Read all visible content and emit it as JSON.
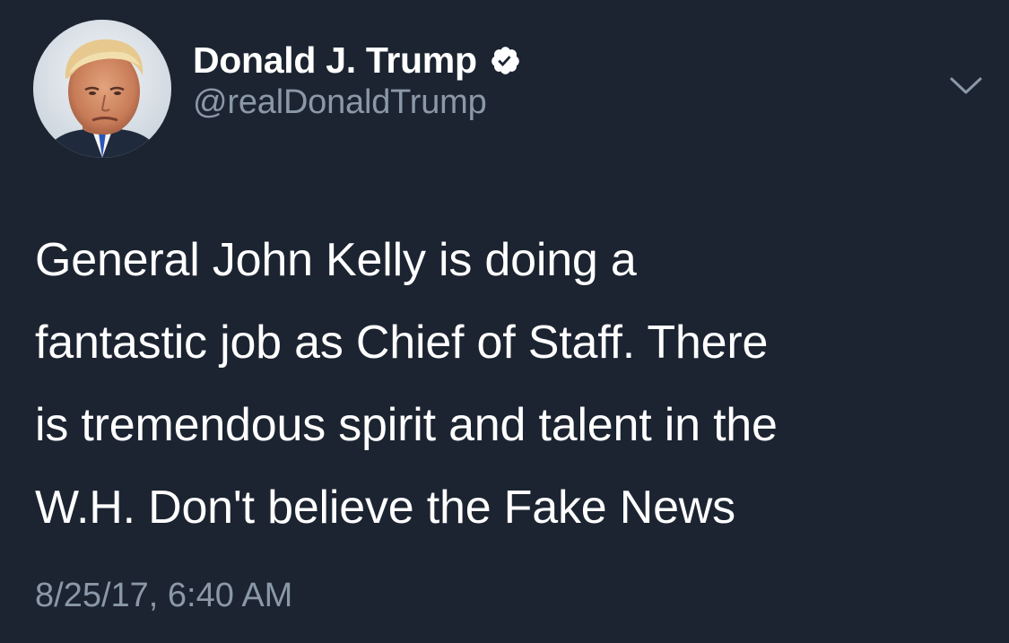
{
  "author": {
    "display_name": "Donald J. Trump",
    "handle": "@realDonaldTrump",
    "verified": true,
    "avatar_icon": "profile-photo-avatar",
    "verified_icon": "verified-badge-icon"
  },
  "menu": {
    "icon": "chevron-down-icon"
  },
  "tweet": {
    "lines": [
      "General John Kelly is doing a",
      "fantastic job as Chief of Staff. There",
      "is tremendous spirit and talent in the",
      "W.H. Don't believe the Fake News"
    ],
    "timestamp": "8/25/17, 6:40 AM"
  },
  "colors": {
    "background": "#1c2431",
    "primary_text": "#ffffff",
    "secondary_text": "#8b98a8"
  }
}
